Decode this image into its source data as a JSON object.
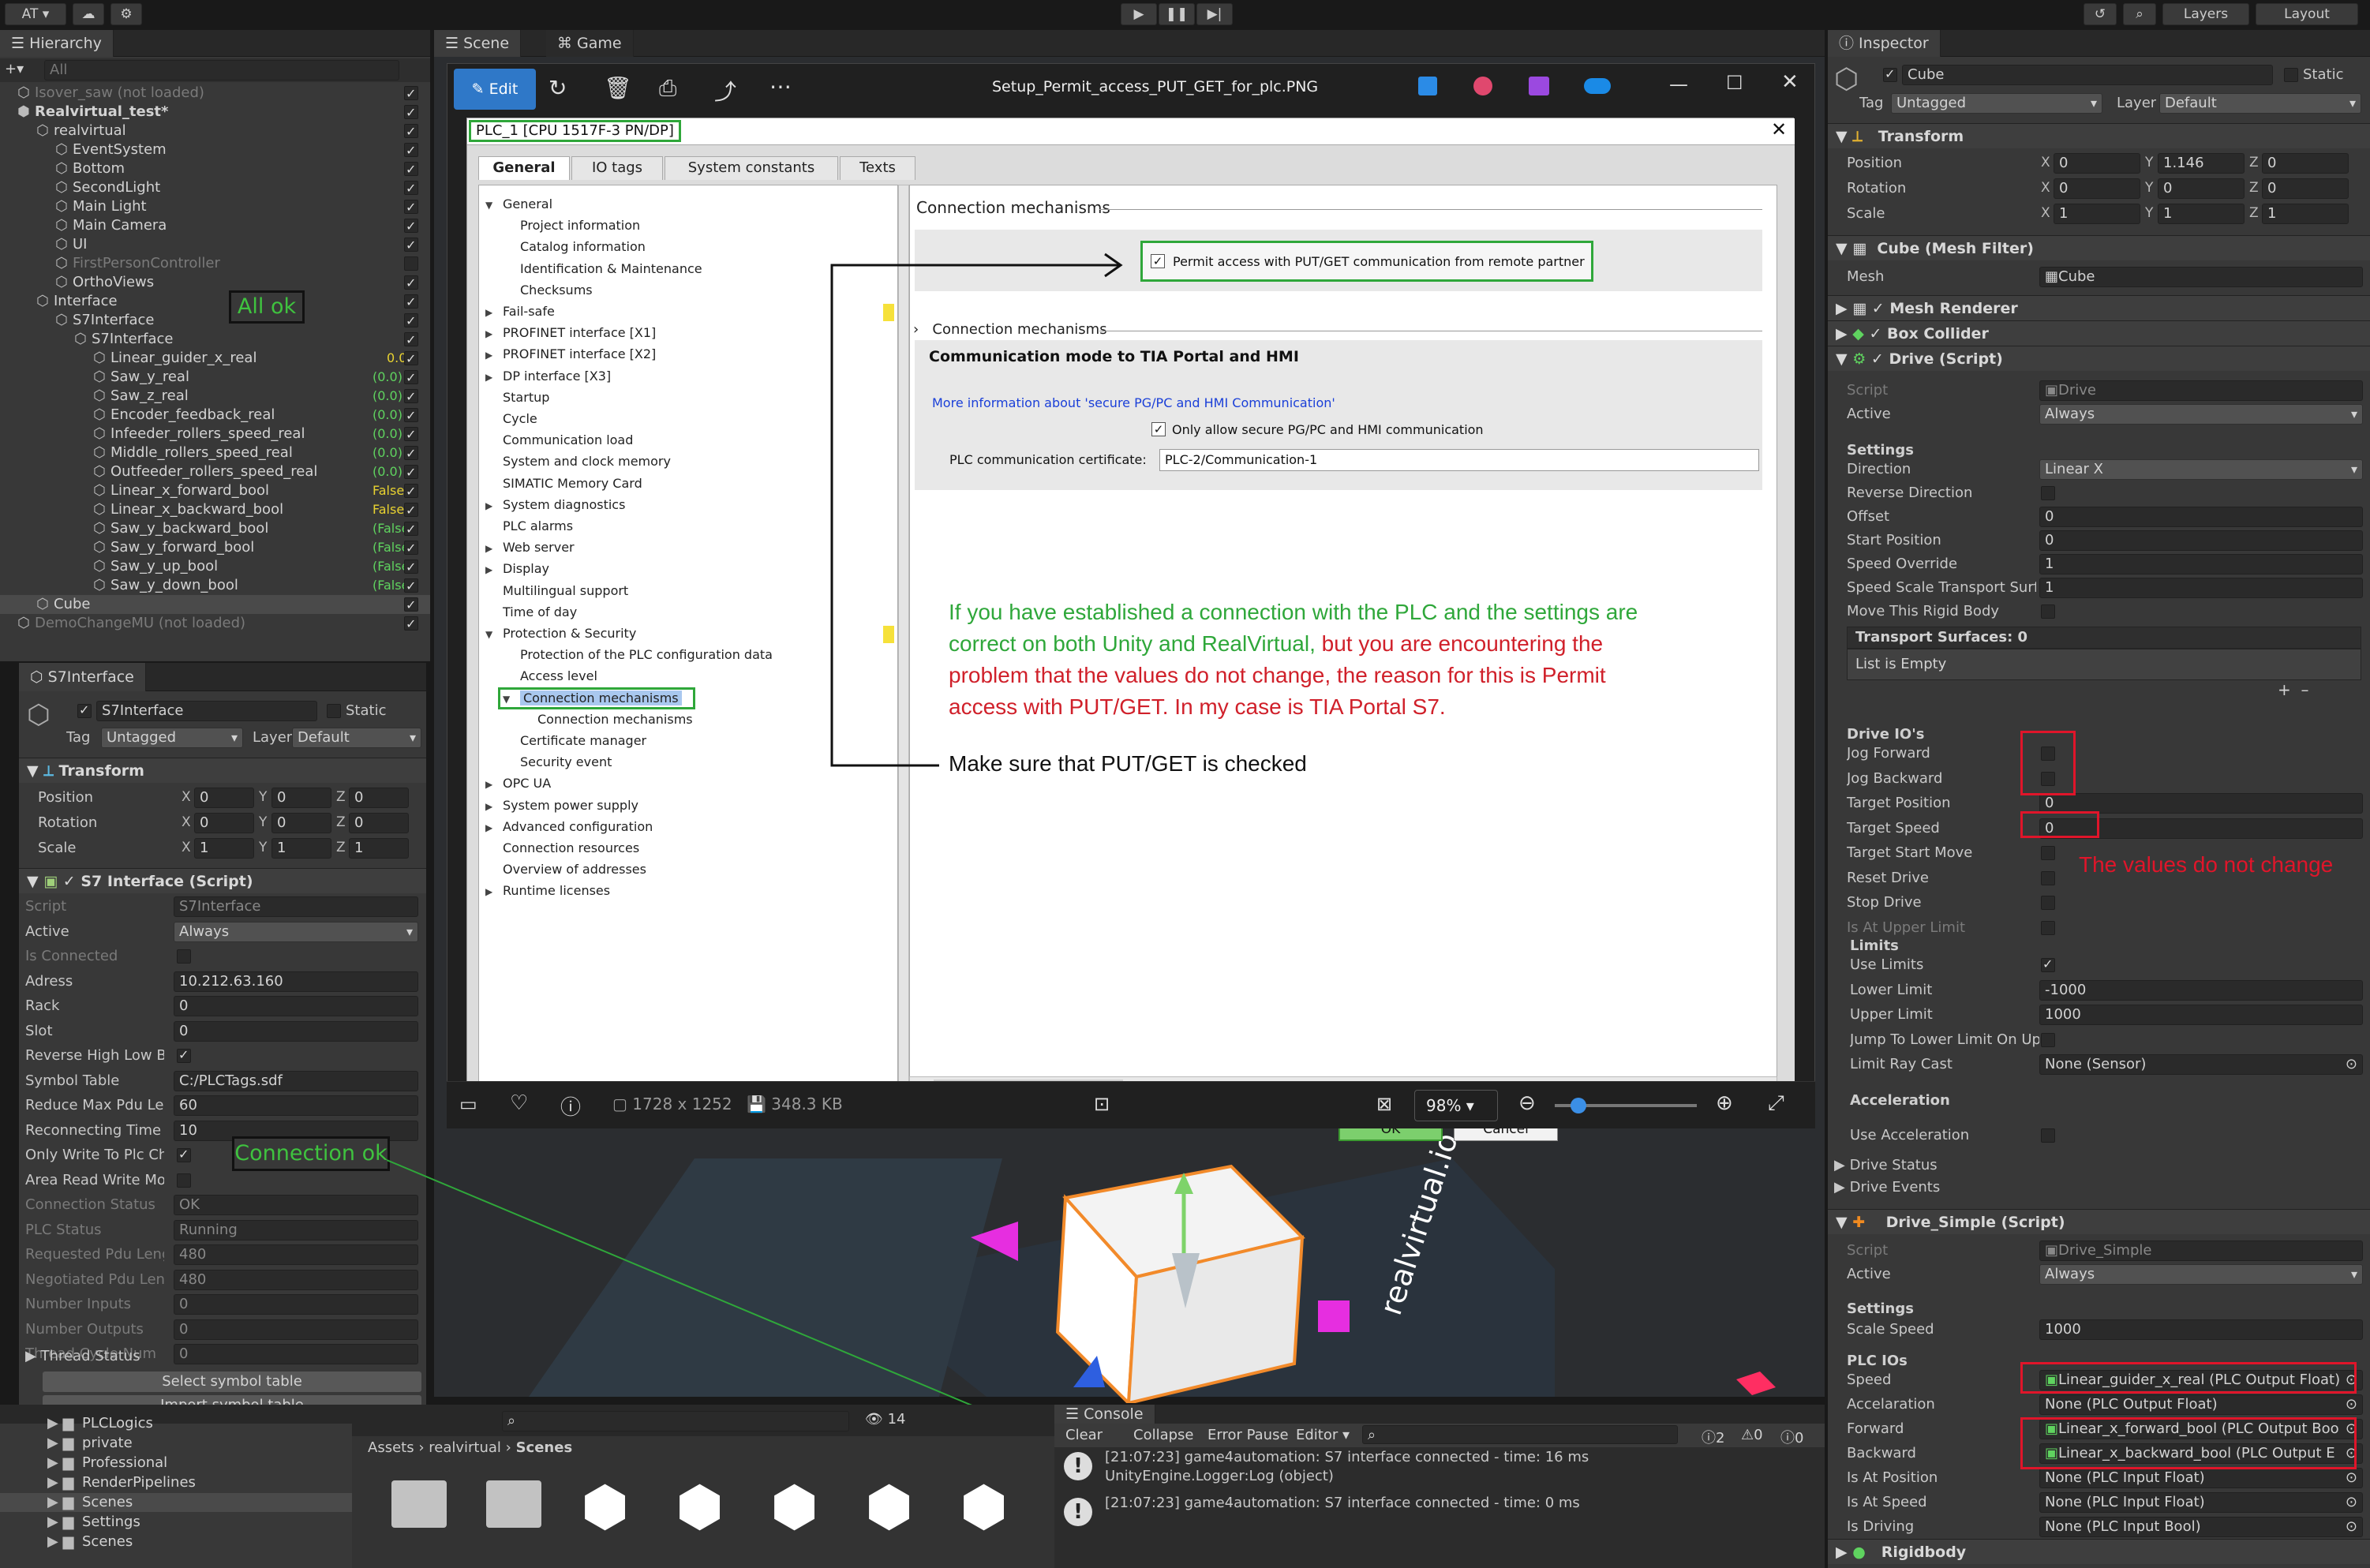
{
  "toolbar": {
    "account": "AT ▾",
    "play": "▶",
    "pause": "❚❚",
    "step": "▶|",
    "layers": "Layers",
    "layout": "Layout"
  },
  "hierarchy": {
    "title": "Hierarchy",
    "search": "All",
    "items": [
      {
        "label": "Isover_saw (not loaded)",
        "indent": 0,
        "dim": true,
        "val": ""
      },
      {
        "label": "Realvirtual_test*",
        "indent": 0,
        "bold": true,
        "val": ""
      },
      {
        "label": "realvirtual",
        "indent": 1,
        "val": ""
      },
      {
        "label": "EventSystem",
        "indent": 2,
        "val": ""
      },
      {
        "label": "Bottom",
        "indent": 2,
        "val": ""
      },
      {
        "label": "SecondLight",
        "indent": 2,
        "val": ""
      },
      {
        "label": "Main Light",
        "indent": 2,
        "val": ""
      },
      {
        "label": "Main Camera",
        "indent": 2,
        "val": ""
      },
      {
        "label": "UI",
        "indent": 2,
        "val": ""
      },
      {
        "label": "FirstPersonController",
        "indent": 2,
        "dim": true,
        "val": ""
      },
      {
        "label": "OrthoViews",
        "indent": 2,
        "val": ""
      },
      {
        "label": "Interface",
        "indent": 1,
        "val": ""
      },
      {
        "label": "S7Interface",
        "indent": 2,
        "val": ""
      },
      {
        "label": "S7Interface",
        "indent": 3,
        "val": ""
      },
      {
        "label": "Linear_guider_x_real",
        "indent": 4,
        "val": "0.0",
        "vc": "y"
      },
      {
        "label": "Saw_y_real",
        "indent": 4,
        "val": "(0.0)",
        "vc": "g"
      },
      {
        "label": "Saw_z_real",
        "indent": 4,
        "val": "(0.0)",
        "vc": "g"
      },
      {
        "label": "Encoder_feedback_real",
        "indent": 4,
        "val": "(0.0)",
        "vc": "g"
      },
      {
        "label": "Infeeder_rollers_speed_real",
        "indent": 4,
        "val": "(0.0)",
        "vc": "g"
      },
      {
        "label": "Middle_rollers_speed_real",
        "indent": 4,
        "val": "(0.0)",
        "vc": "g"
      },
      {
        "label": "Outfeeder_rollers_speed_real",
        "indent": 4,
        "val": "(0.0)",
        "vc": "g"
      },
      {
        "label": "Linear_x_forward_bool",
        "indent": 4,
        "val": "False",
        "vc": "y"
      },
      {
        "label": "Linear_x_backward_bool",
        "indent": 4,
        "val": "False",
        "vc": "y"
      },
      {
        "label": "Saw_y_backward_bool",
        "indent": 4,
        "val": "(False)",
        "vc": "g"
      },
      {
        "label": "Saw_y_forward_bool",
        "indent": 4,
        "val": "(False)",
        "vc": "g"
      },
      {
        "label": "Saw_y_up_bool",
        "indent": 4,
        "val": "(False)",
        "vc": "g"
      },
      {
        "label": "Saw_y_down_bool",
        "indent": 4,
        "val": "(False)",
        "vc": "g"
      },
      {
        "label": "Cube",
        "indent": 1,
        "val": "",
        "sel": true
      },
      {
        "label": "DemoChangeMU (not loaded)",
        "indent": 0,
        "dim": true,
        "val": ""
      }
    ]
  },
  "annot": {
    "allok": "All ok",
    "connok": "Connection ok",
    "putget": "Make sure that PUT/GET is checked",
    "nochange": "The values do not change",
    "explain_green": "If you have established a connection with the PLC and the settings are",
    "explain_line2_green": "correct on both Unity and RealVirtual,",
    "explain_line2_red": " but you are encountering the",
    "explain_line3": "problem that the values do not change, the reason for this is Permit",
    "explain_line4": "access with PUT/GET. In my case is TIA Portal S7."
  },
  "s7panel": {
    "title": "S7Interface",
    "name": "S7Interface",
    "static": "Static",
    "tag_label": "Tag",
    "tag": "Untagged",
    "layer_label": "Layer",
    "layer": "Default",
    "transform": "Transform",
    "position": "Position",
    "rotation": "Rotation",
    "scale": "Scale",
    "pos": [
      "0",
      "0",
      "0"
    ],
    "rot": [
      "0",
      "0",
      "0"
    ],
    "scl": [
      "1",
      "1",
      "1"
    ],
    "script_title": "S7 Interface (Script)",
    "rows": [
      {
        "label": "Script",
        "value": "S7Interface",
        "dim": true
      },
      {
        "label": "Active",
        "value": "Always",
        "drop": true
      },
      {
        "label": "Is Connected",
        "value": "",
        "check": true,
        "dim": true
      },
      {
        "label": "Adress",
        "value": "10.212.63.160"
      },
      {
        "label": "Rack",
        "value": "0"
      },
      {
        "label": "Slot",
        "value": "0"
      },
      {
        "label": "Reverse High Low B",
        "value": "",
        "check": true,
        "on": true
      },
      {
        "label": "Symbol Table",
        "value": "C:/PLCTags.sdf"
      },
      {
        "label": "Reduce Max Pdu Le",
        "value": "60"
      },
      {
        "label": "Reconnecting Time",
        "value": "10"
      },
      {
        "label": "Only Write To Plc Ch",
        "value": "",
        "check": true,
        "on": true
      },
      {
        "label": "Area Read Write Moc",
        "value": "",
        "check": true
      },
      {
        "label": "Connection Status",
        "value": "OK",
        "dim": true
      },
      {
        "label": "PLC Status",
        "value": "Running",
        "dim": true
      },
      {
        "label": "Requested Pdu Leng",
        "value": "480",
        "dim": true
      },
      {
        "label": "Negotiated Pdu Len",
        "value": "480",
        "dim": true
      },
      {
        "label": "Number Inputs",
        "value": "0",
        "dim": true
      },
      {
        "label": "Number Outputs",
        "value": "0",
        "dim": true
      },
      {
        "label": "Thread Cycle Num",
        "value": "0",
        "dim": true
      }
    ],
    "thread_status": "Thread Status",
    "select_btn": "Select symbol table",
    "import_btn": "Import symbol table"
  },
  "scene": {
    "tab_scene": "Scene",
    "tab_game": "Game",
    "brand": "realvirtual.io"
  },
  "viewer": {
    "edit": "Edit",
    "filename": "Setup_Permit_access_PUT_GET_for_plc.PNG",
    "dims": "1728 x 1252",
    "size": "348.3 KB",
    "zoom": "98%"
  },
  "tia": {
    "title": "PLC_1 [CPU 1517F-3 PN/DP]",
    "tabs": [
      "General",
      "IO tags",
      "System constants",
      "Texts"
    ],
    "tree": [
      {
        "t": "General",
        "l": 0,
        "a": "▼"
      },
      {
        "t": "Project information",
        "l": 1
      },
      {
        "t": "Catalog information",
        "l": 1
      },
      {
        "t": "Identification & Maintenance",
        "l": 1
      },
      {
        "t": "Checksums",
        "l": 1
      },
      {
        "t": "Fail-safe",
        "l": 0,
        "a": "▶"
      },
      {
        "t": "PROFINET interface [X1]",
        "l": 0,
        "a": "▶"
      },
      {
        "t": "PROFINET interface [X2]",
        "l": 0,
        "a": "▶"
      },
      {
        "t": "DP interface [X3]",
        "l": 0,
        "a": "▶"
      },
      {
        "t": "Startup",
        "l": 0
      },
      {
        "t": "Cycle",
        "l": 0
      },
      {
        "t": "Communication load",
        "l": 0
      },
      {
        "t": "System and clock memory",
        "l": 0
      },
      {
        "t": "SIMATIC Memory Card",
        "l": 0
      },
      {
        "t": "System diagnostics",
        "l": 0,
        "a": "▶"
      },
      {
        "t": "PLC alarms",
        "l": 0
      },
      {
        "t": "Web server",
        "l": 0,
        "a": "▶"
      },
      {
        "t": "Display",
        "l": 0,
        "a": "▶"
      },
      {
        "t": "Multilingual support",
        "l": 0
      },
      {
        "t": "Time of day",
        "l": 0
      },
      {
        "t": "Protection & Security",
        "l": 0,
        "a": "▼"
      },
      {
        "t": "Protection of the PLC configuration data",
        "l": 1
      },
      {
        "t": "Access level",
        "l": 1
      },
      {
        "t": "Connection mechanisms",
        "l": 1,
        "a": "▼",
        "sel": true
      },
      {
        "t": "Connection mechanisms",
        "l": 2
      },
      {
        "t": "Certificate manager",
        "l": 1
      },
      {
        "t": "Security event",
        "l": 1
      },
      {
        "t": "OPC UA",
        "l": 0,
        "a": "▶"
      },
      {
        "t": "System power supply",
        "l": 0,
        "a": "▶"
      },
      {
        "t": "Advanced configuration",
        "l": 0,
        "a": "▶"
      },
      {
        "t": "Connection resources",
        "l": 0
      },
      {
        "t": "Overview of addresses",
        "l": 0
      },
      {
        "t": "Runtime licenses",
        "l": 0,
        "a": "▶"
      }
    ],
    "conn_mech": "Connection mechanisms",
    "permit": "Permit access with PUT/GET communication from remote partner",
    "conn_mech2": "Connection mechanisms",
    "comm_mode": "Communication mode to TIA Portal and HMI",
    "more_info": "More information about 'secure PG/PC and HMI Communication'",
    "only_secure": "Only allow secure PG/PC and HMI communication",
    "cert_label": "PLC communication certificate:",
    "cert_value": "PLC-2/Communication-1",
    "ok": "OK",
    "cancel": "Cancel"
  },
  "inspector": {
    "title": "Inspector",
    "name": "Cube",
    "static": "Static",
    "tag_label": "Tag",
    "tag": "Untagged",
    "layer_label": "Layer",
    "layer": "Default",
    "transform": "Transform",
    "position": "Position",
    "rotation": "Rotation",
    "scale": "Scale",
    "pos": [
      "0",
      "1.146",
      "0"
    ],
    "rot": [
      "0",
      "0",
      "0"
    ],
    "scl": [
      "1",
      "1",
      "1"
    ],
    "mesh_filter": "Cube (Mesh Filter)",
    "mesh_label": "Mesh",
    "mesh": "Cube",
    "mesh_renderer": "Mesh Renderer",
    "box_collider": "Box Collider",
    "drive": "Drive (Script)",
    "drive_script": "Drive",
    "active": "Always",
    "settings": "Settings",
    "drive_rows": [
      {
        "label": "Direction",
        "value": "Linear X",
        "drop": true
      },
      {
        "label": "Reverse Direction",
        "check": true
      },
      {
        "label": "Offset",
        "value": "0"
      },
      {
        "label": "Start Position",
        "value": "0"
      },
      {
        "label": "Speed Override",
        "value": "1"
      },
      {
        "label": "Speed Scale Transport Surf",
        "value": "1"
      },
      {
        "label": "Move This Rigid Body",
        "check": true
      }
    ],
    "transport": "Transport Surfaces: 0",
    "list_empty": "List is Empty",
    "drive_ios": "Drive IO's",
    "io_rows": [
      {
        "label": "Jog Forward",
        "check": true
      },
      {
        "label": "Jog Backward",
        "check": true
      },
      {
        "label": "Target Position",
        "value": "0"
      },
      {
        "label": "Target Speed",
        "value": "0"
      },
      {
        "label": "Target Start Move",
        "check": true
      },
      {
        "label": "Reset Drive",
        "check": true
      },
      {
        "label": "Stop Drive",
        "check": true
      },
      {
        "label": "Is At Upper Limit",
        "check": true,
        "dim": true
      }
    ],
    "limits": "Limits",
    "limit_rows": [
      {
        "label": "Use Limits",
        "check": true,
        "on": true
      },
      {
        "label": "Lower Limit",
        "value": "-1000"
      },
      {
        "label": "Upper Limit",
        "value": "1000"
      },
      {
        "label": "Jump To Lower Limit On Up",
        "check": true
      },
      {
        "label": "Limit Ray Cast",
        "value": "None (Sensor)",
        "obj": true
      }
    ],
    "accel": "Acceleration",
    "use_accel": "Use Acceleration",
    "drive_status": "Drive Status",
    "drive_events": "Drive Events",
    "drive_simple": "Drive_Simple (Script)",
    "ds_script": "Drive_Simple",
    "ds_active": "Always",
    "ds_settings": "Settings",
    "scale_speed_label": "Scale Speed",
    "scale_speed": "1000",
    "plc_ios": "PLC IOs",
    "plc_rows": [
      {
        "label": "Speed",
        "value": "Linear_guider_x_real (PLC Output Float)",
        "g": true
      },
      {
        "label": "Accelaration",
        "value": "None (PLC Output Float)"
      },
      {
        "label": "Forward",
        "value": "Linear_x_forward_bool (PLC Output Boo",
        "g": true
      },
      {
        "label": "Backward",
        "value": "Linear_x_backward_bool (PLC Output E",
        "g": true
      },
      {
        "label": "Is At Position",
        "value": "None (PLC Input Float)"
      },
      {
        "label": "Is At Speed",
        "value": "None (PLC Input Float)"
      },
      {
        "label": "Is Driving",
        "value": "None (PLC Input Bool)"
      }
    ],
    "rigidbody": "Rigidbody"
  },
  "project": {
    "folders": [
      "PLCLogics",
      "private",
      "Professional",
      "RenderPipelines",
      "Scenes",
      "Settings",
      "Scenes"
    ],
    "breadcrumb": [
      "Assets",
      "realvirtual",
      "Scenes"
    ],
    "count": "14"
  },
  "console": {
    "title": "Console",
    "clear": "Clear",
    "collapse": "Collapse",
    "error_pause": "Error Pause",
    "editor": "Editor",
    "c1": "2",
    "c2": "0",
    "c3": "0",
    "msgs": [
      {
        "l1": "[21:07:23] game4automation: S7 interface connected - time: 16 ms",
        "l2": "UnityEngine.Logger:Log (object)"
      },
      {
        "l1": "[21:07:23] game4automation: S7 interface connected - time: 0 ms",
        "l2": ""
      }
    ]
  }
}
